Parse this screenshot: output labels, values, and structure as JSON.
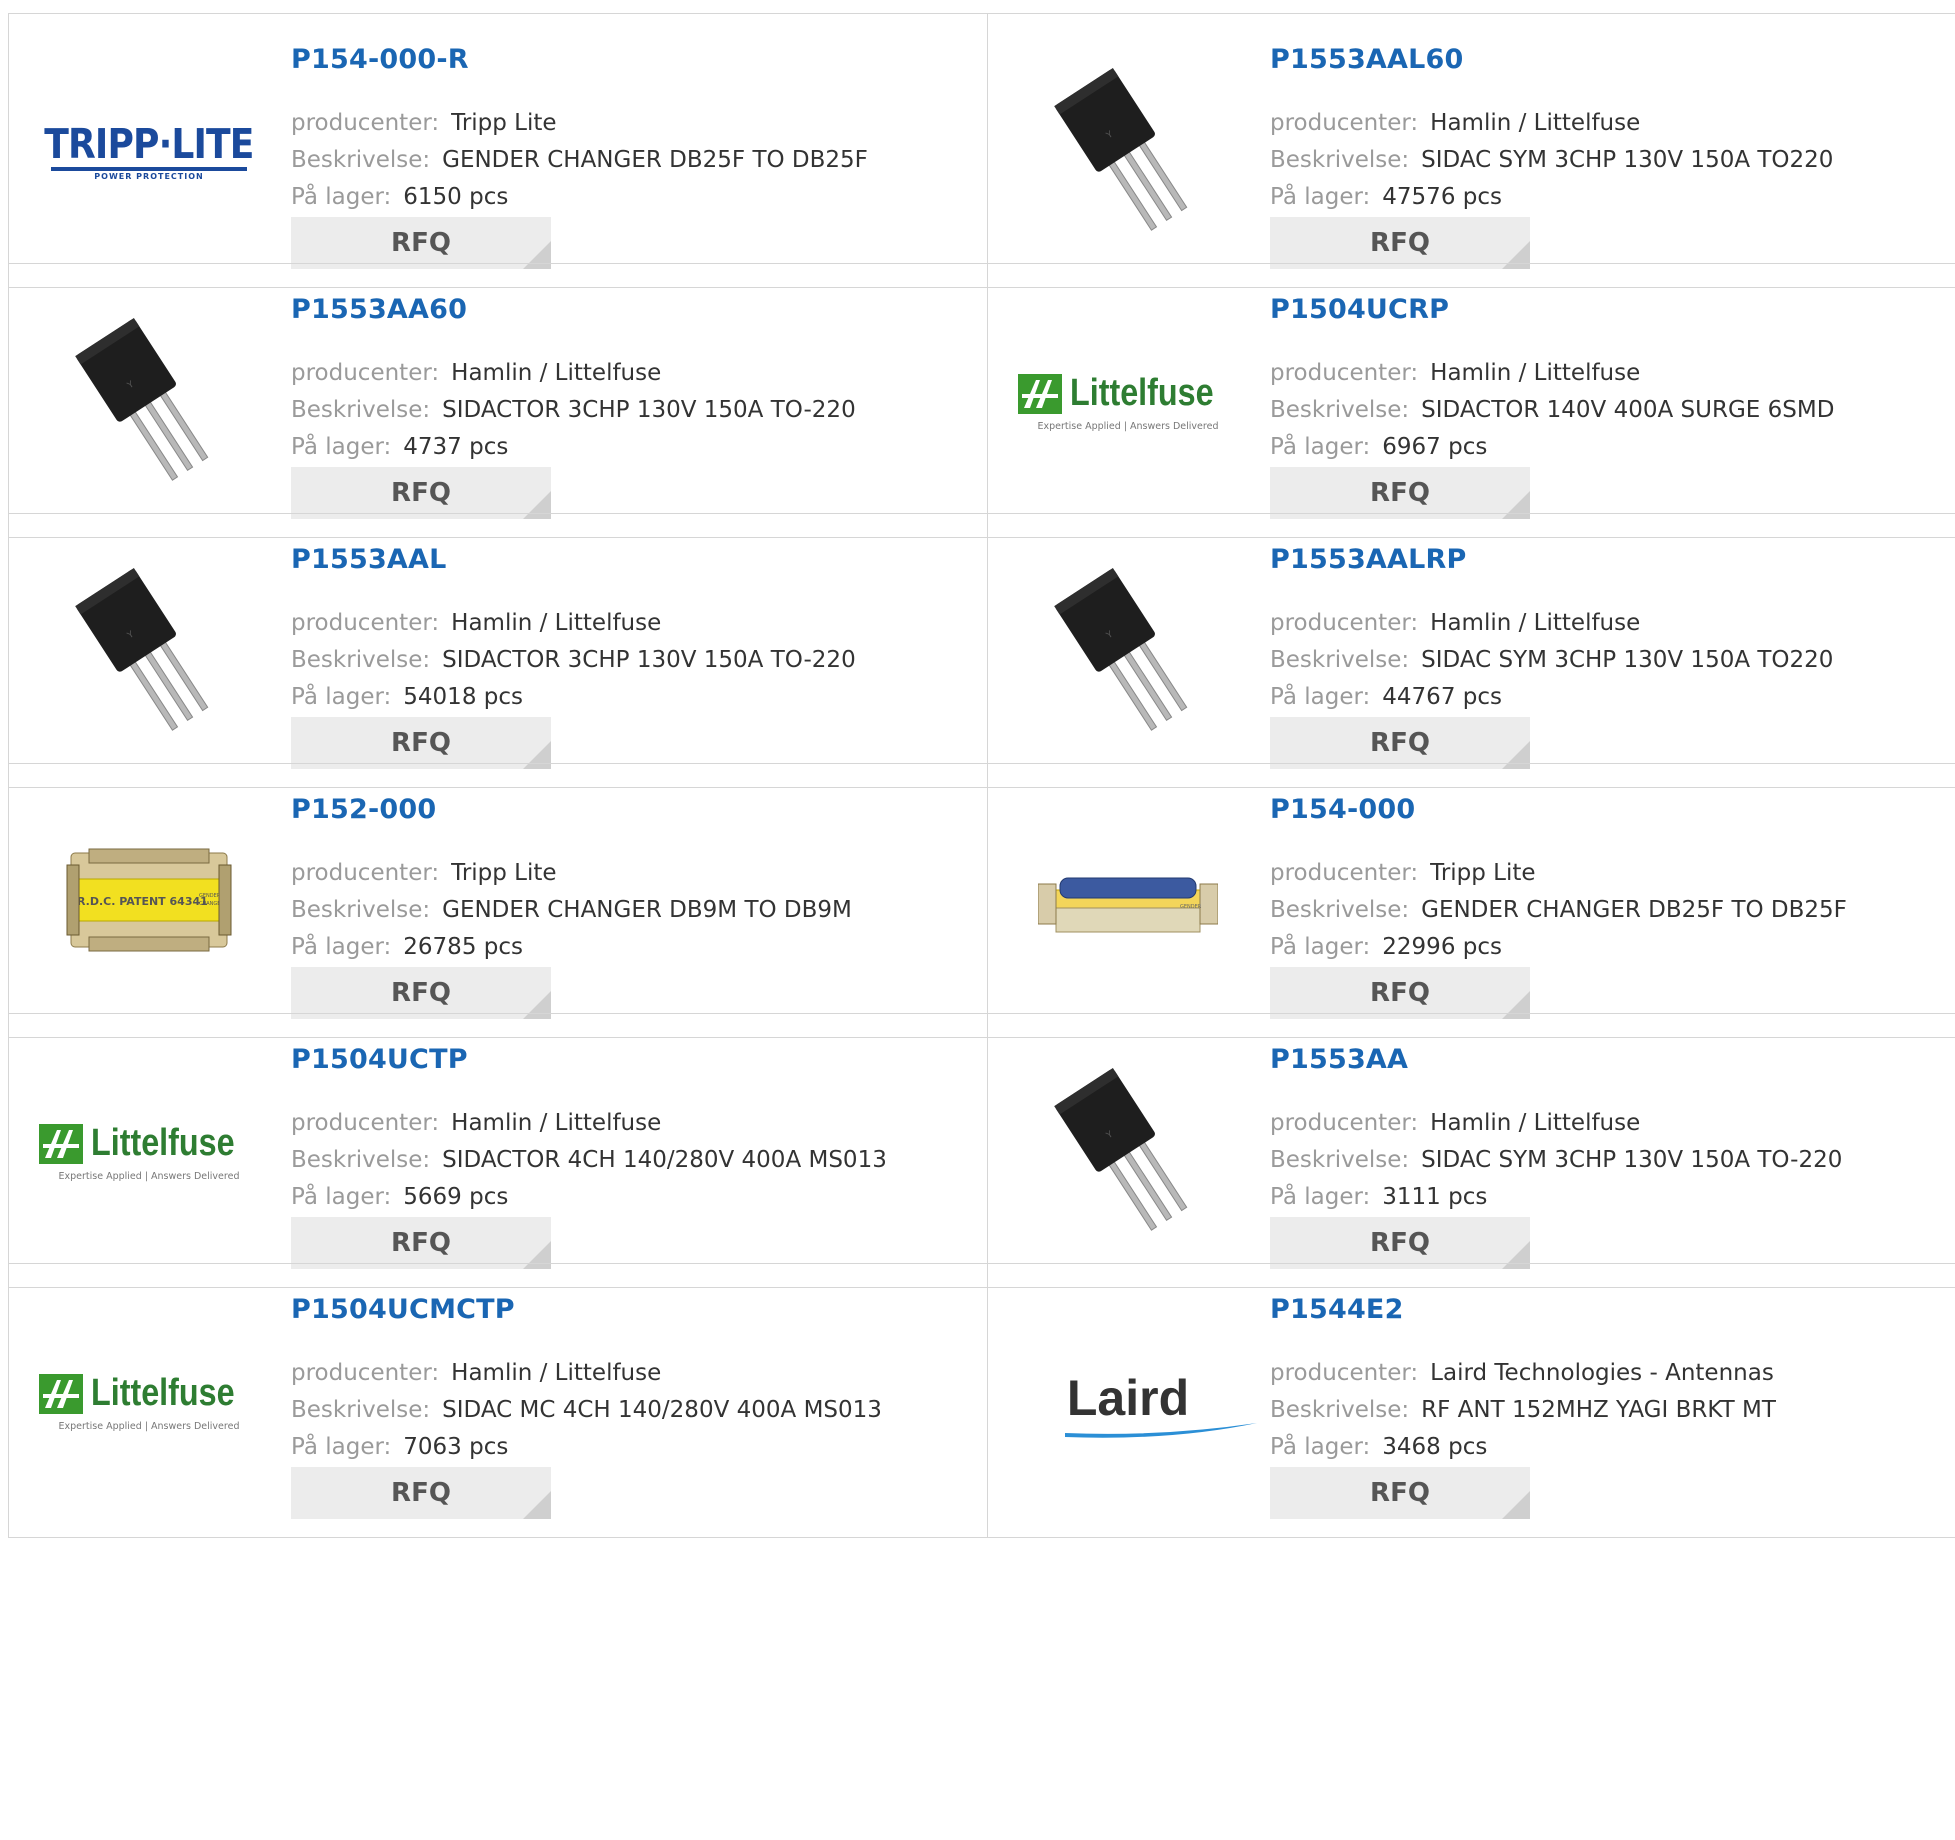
{
  "labels": {
    "manufacturer": "producenter:",
    "description": "Beskrivelse:",
    "stock": "På lager:",
    "rfq": "RFQ"
  },
  "products": [
    {
      "part": "P154-000-R",
      "manufacturer": "Tripp Lite",
      "description": "GENDER CHANGER DB25F TO DB25F",
      "stock": "6150 pcs",
      "image": "tripp-lite-logo"
    },
    {
      "part": "P1553AAL60",
      "manufacturer": "Hamlin / Littelfuse",
      "description": "SIDAC SYM 3CHP 130V 150A TO220",
      "stock": "47576 pcs",
      "image": "to220-transistor-icon"
    },
    {
      "part": "P1553AA60",
      "manufacturer": "Hamlin / Littelfuse",
      "description": "SIDACTOR 3CHP 130V 150A TO-220",
      "stock": "4737 pcs",
      "image": "to220-transistor-icon"
    },
    {
      "part": "P1504UCRP",
      "manufacturer": "Hamlin / Littelfuse",
      "description": "SIDACTOR 140V 400A SURGE 6SMD",
      "stock": "6967 pcs",
      "image": "littelfuse-logo"
    },
    {
      "part": "P1553AAL",
      "manufacturer": "Hamlin / Littelfuse",
      "description": "SIDACTOR 3CHP 130V 150A TO-220",
      "stock": "54018 pcs",
      "image": "to220-transistor-icon"
    },
    {
      "part": "P1553AALRP",
      "manufacturer": "Hamlin / Littelfuse",
      "description": "SIDAC SYM 3CHP 130V 150A TO220",
      "stock": "44767 pcs",
      "image": "to220-transistor-icon"
    },
    {
      "part": "P152-000",
      "manufacturer": "Tripp Lite",
      "description": "GENDER CHANGER DB9M TO DB9M",
      "stock": "26785 pcs",
      "image": "db9-gender-changer-photo"
    },
    {
      "part": "P154-000",
      "manufacturer": "Tripp Lite",
      "description": "GENDER CHANGER DB25F TO DB25F",
      "stock": "22996 pcs",
      "image": "db25-gender-changer-photo"
    },
    {
      "part": "P1504UCTP",
      "manufacturer": "Hamlin / Littelfuse",
      "description": "SIDACTOR 4CH 140/280V 400A MS013",
      "stock": "5669 pcs",
      "image": "littelfuse-logo"
    },
    {
      "part": "P1553AA",
      "manufacturer": "Hamlin / Littelfuse",
      "description": "SIDAC SYM 3CHP 130V 150A TO-220",
      "stock": "3111 pcs",
      "image": "to220-transistor-icon"
    },
    {
      "part": "P1504UCMCTP",
      "manufacturer": "Hamlin / Littelfuse",
      "description": "SIDAC MC 4CH 140/280V 400A MS013",
      "stock": "7063 pcs",
      "image": "littelfuse-logo"
    },
    {
      "part": "P1544E2",
      "manufacturer": "Laird Technologies - Antennas",
      "description": "RF ANT 152MHZ YAGI BRKT MT",
      "stock": "3468 pcs",
      "image": "laird-logo"
    }
  ],
  "logos": {
    "tripp": {
      "text": "TRIPP·LITE",
      "sub": "POWER PROTECTION"
    },
    "littelfuse": {
      "text": "Littelfuse",
      "tagline": "Expertise Applied | Answers Delivered"
    },
    "laird": {
      "text": "Laird"
    },
    "rdc": {
      "text": "R.D.C. PATENT 64341",
      "small": "GENDER CHANGER"
    }
  },
  "colors": {
    "link": "#1a66b3",
    "label": "#9a9a9a",
    "value": "#333333",
    "button": "#ececec",
    "border": "#d6d6d6"
  }
}
